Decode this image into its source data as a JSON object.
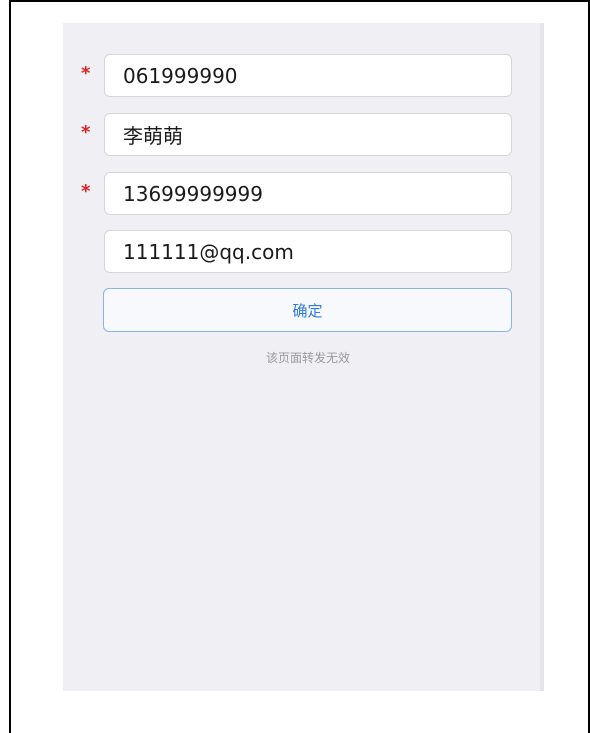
{
  "form": {
    "fields": [
      {
        "value": "061999990",
        "required": true,
        "required_marker": "*"
      },
      {
        "value": "李萌萌",
        "required": true,
        "required_marker": "*"
      },
      {
        "value": "13699999999",
        "required": true,
        "required_marker": "*"
      },
      {
        "value": "111111@qq.com",
        "required": false
      }
    ],
    "confirm_label": "确定",
    "notice": "该页面转发无效"
  },
  "colors": {
    "panel_background": "#efeff4",
    "required_marker": "#e02020",
    "button_accent": "#2e7bd8",
    "button_border": "#8ab4ea",
    "notice_text": "#9a9a9e"
  }
}
